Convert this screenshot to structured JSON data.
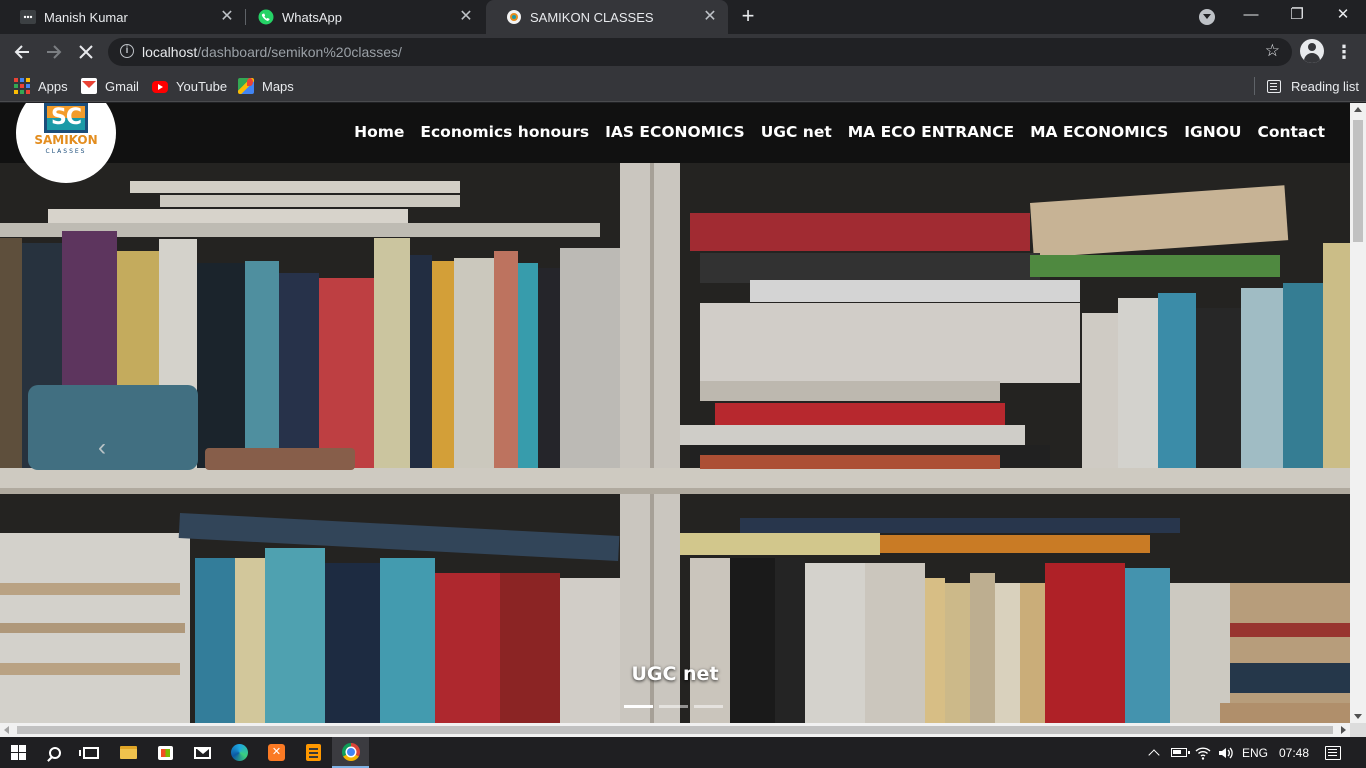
{
  "browser": {
    "tabs": [
      {
        "title": "Manish Kumar",
        "favicon": "dots-icon",
        "active": false
      },
      {
        "title": "WhatsApp",
        "favicon": "whatsapp-icon",
        "active": false
      },
      {
        "title": "SAMIKON CLASSES",
        "favicon": "site-favicon",
        "active": true
      }
    ],
    "tab_close_glyph": "✕",
    "new_tab_glyph": "+",
    "window_controls": {
      "minimize": "—",
      "restore": "❐",
      "close": "✕"
    },
    "url": {
      "host": "localhost",
      "path": "/dashboard/semikon%20classes/"
    },
    "bookmarks": [
      {
        "label": "Apps",
        "icon": "apps-grid-icon"
      },
      {
        "label": "Gmail",
        "icon": "gmail-icon"
      },
      {
        "label": "YouTube",
        "icon": "youtube-icon"
      },
      {
        "label": "Maps",
        "icon": "maps-icon"
      }
    ],
    "reading_list": "Reading list"
  },
  "site": {
    "logo": {
      "mark": "SC",
      "brand": "SAMIKON",
      "sub": "CLASSES"
    },
    "nav": [
      {
        "label": "Home"
      },
      {
        "label": "Economics honours"
      },
      {
        "label": "IAS ECONOMICS"
      },
      {
        "label": "UGC net"
      },
      {
        "label": "MA ECO ENTRANCE"
      },
      {
        "label": "MA ECONOMICS"
      },
      {
        "label": "IGNOU"
      },
      {
        "label": "Contact"
      }
    ],
    "carousel": {
      "caption": "UGC net",
      "prev_glyph": "‹",
      "slide_count": 3,
      "active_index": 0
    }
  },
  "taskbar": {
    "apps": [
      "start-icon",
      "search-icon",
      "task-view-icon",
      "file-explorer-icon",
      "store-icon",
      "mail-icon",
      "edge-icon",
      "xampp-icon",
      "sublime-text-icon",
      "chrome-icon"
    ],
    "xampp_glyph": "✕",
    "language": "ENG",
    "time": "07:48"
  },
  "colors": {
    "chrome_dark": "#202124",
    "chrome_toolbar": "#35363a",
    "site_nav": "#111111",
    "logo_orange": "#e38d1f",
    "logo_teal": "#1b9aa7"
  }
}
